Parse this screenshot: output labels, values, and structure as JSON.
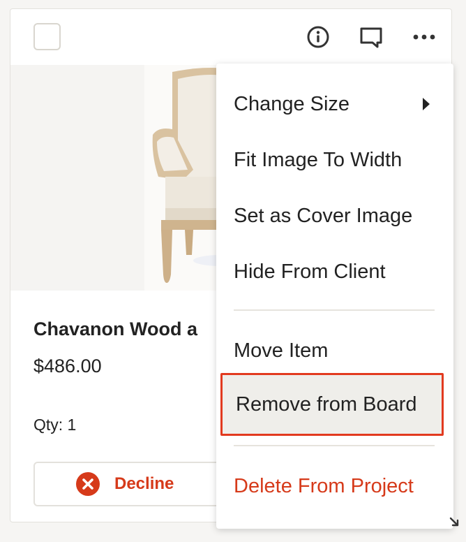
{
  "card": {
    "title": "Chavanon Wood a",
    "price": "$486.00",
    "qty": "Qty: 1",
    "decline_label": "Decline",
    "icons": {
      "select": "checkbox",
      "info": "info-icon",
      "comment": "comment-icon",
      "more": "more-horizontal-icon",
      "decline": "close-circle-icon"
    }
  },
  "menu": {
    "items": [
      {
        "label": "Change Size",
        "has_submenu": true
      },
      {
        "label": "Fit Image To Width"
      },
      {
        "label": "Set as Cover Image"
      },
      {
        "label": "Hide From Client"
      },
      {
        "label": "Move Item"
      },
      {
        "label": "Remove from Board",
        "highlighted": true
      },
      {
        "label": "Delete From Project",
        "danger": true
      }
    ]
  },
  "colors": {
    "accent_red": "#d63a1a",
    "highlight_border": "#e23a1f",
    "highlight_bg": "#efeeea"
  }
}
